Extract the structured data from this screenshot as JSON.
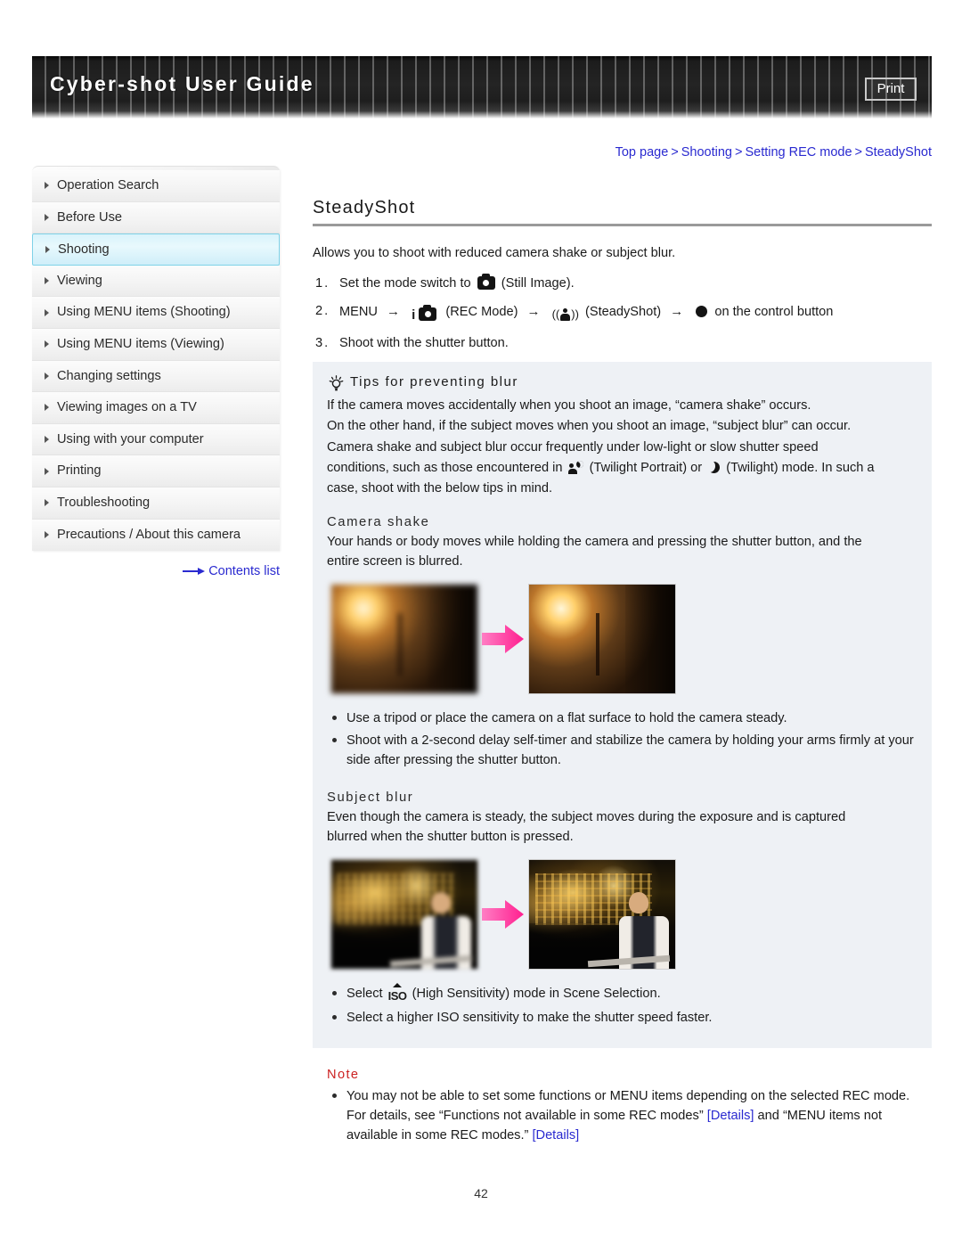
{
  "header": {
    "title": "Cyber-shot User Guide",
    "print_label": "Print"
  },
  "breadcrumb": {
    "items": [
      "Top page",
      "Shooting",
      "Setting REC mode",
      "SteadyShot"
    ],
    "separator": ">"
  },
  "sidebar": {
    "items": [
      {
        "label": "Operation Search",
        "active": false
      },
      {
        "label": "Before Use",
        "active": false
      },
      {
        "label": "Shooting",
        "active": true
      },
      {
        "label": "Viewing",
        "active": false
      },
      {
        "label": "Using MENU items (Shooting)",
        "active": false
      },
      {
        "label": "Using MENU items (Viewing)",
        "active": false
      },
      {
        "label": "Changing settings",
        "active": false
      },
      {
        "label": "Viewing images on a TV",
        "active": false
      },
      {
        "label": "Using with your computer",
        "active": false
      },
      {
        "label": "Printing",
        "active": false
      },
      {
        "label": "Troubleshooting",
        "active": false
      },
      {
        "label": "Precautions / About this camera",
        "active": false
      }
    ],
    "contents_link": "Contents list"
  },
  "main": {
    "title": "SteadyShot",
    "intro": "Allows you to shoot with reduced camera shake or subject blur.",
    "steps": [
      {
        "num": "1.",
        "pre": "Set the mode switch to",
        "post": "(Still Image)."
      },
      {
        "num": "2.",
        "menu": "MENU",
        "rec_label": "(REC Mode)",
        "steady_label": "(SteadyShot)",
        "tail": "on the control button"
      },
      {
        "num": "3.",
        "text": "Shoot with the shutter button."
      }
    ],
    "arrow": "→"
  },
  "tips": {
    "heading": "Tips for preventing blur",
    "paragraph_1": "If the camera moves accidentally when you shoot an image, “camera shake” occurs.",
    "paragraph_2": "On the other hand, if the subject moves when you shoot an image, “subject blur” can occur.",
    "paragraph_3": "Camera shake and subject blur occur frequently under low-light or slow shutter speed",
    "paragraph_4_pre": "conditions, such as those encountered in",
    "paragraph_4_mid": "(Twilight Portrait) or",
    "paragraph_4_post": "(Twilight) mode. In such a",
    "paragraph_5": "case, shoot with the below tips in mind.",
    "camera_shake": {
      "heading": "Camera shake",
      "body_line_1": "Your hands or body moves while holding the camera and pressing the shutter button, and the",
      "body_line_2": "entire screen is blurred.",
      "image_before_alt": "blurred photo of wall lamps",
      "image_after_alt": "sharp photo of wall lamps",
      "bullets": [
        "Use a tripod or place the camera on a flat surface to hold the camera steady.",
        "Shoot with a 2-second delay self-timer and stabilize the camera by holding your arms firmly at your side after pressing the shutter button."
      ]
    },
    "subject_blur": {
      "heading": "Subject blur",
      "body_line_1": "Even though the camera is steady, the subject moves during the exposure and is captured",
      "body_line_2": "blurred when the shutter button is pressed.",
      "image_before_alt": "blurred photo of person in front of night city",
      "image_after_alt": "sharp photo of person in front of night city",
      "bullet_1_pre": "Select",
      "bullet_1_post": "(High Sensitivity) mode in Scene Selection.",
      "bullet_2": "Select a higher ISO sensitivity to make the shutter speed faster."
    }
  },
  "note": {
    "heading": "Note",
    "line_1": "You may not be able to set some functions or MENU items depending on the selected REC",
    "line_2_pre": "mode. For details, see “Functions not available in some REC modes”",
    "details_1": "[Details]",
    "line_2_post": "and “MENU",
    "line_3_pre": "items not available in some REC modes.”",
    "details_2": "[Details]"
  },
  "footer": {
    "page_number": "42"
  },
  "colors": {
    "link": "#2a2ad0",
    "note": "#cc2222",
    "tips_bg": "#eef1f5",
    "active_nav": "#d9f3fb",
    "arrow_pink": "#ff3399"
  }
}
